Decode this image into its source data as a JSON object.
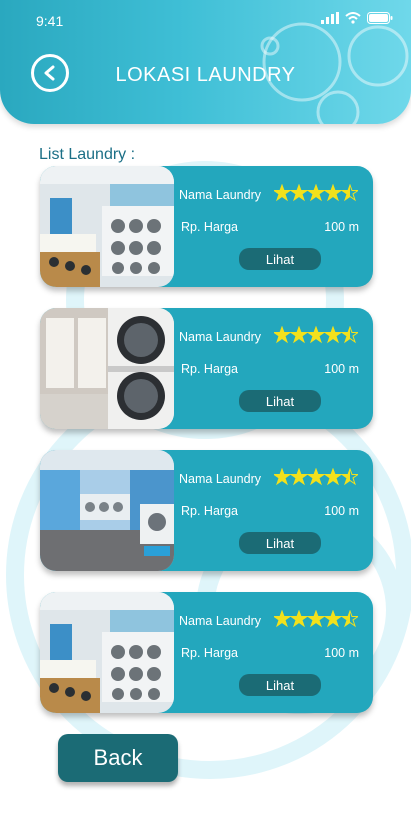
{
  "status_bar": {
    "time": "9:41"
  },
  "header": {
    "title": "LOKASI LAUNDRY",
    "back_icon": "chevron-left-icon"
  },
  "list_label": "List Laundry :",
  "laundries": [
    {
      "name": "Nama Laundry",
      "price": "Rp. Harga",
      "distance": "100 m",
      "rating": 4.5,
      "button": "Lihat"
    },
    {
      "name": "Nama Laundry",
      "price": "Rp. Harga",
      "distance": "100 m",
      "rating": 4.5,
      "button": "Lihat"
    },
    {
      "name": "Nama Laundry",
      "price": "Rp. Harga",
      "distance": "100 m",
      "rating": 4.5,
      "button": "Lihat"
    },
    {
      "name": "Nama Laundry",
      "price": "Rp. Harga",
      "distance": "100 m",
      "rating": 4.5,
      "button": "Lihat"
    }
  ],
  "back_button": "Back",
  "colors": {
    "header": "#2aa8bf",
    "card": "#23a7bd",
    "button": "#1b6b75",
    "star": "#f2e11c",
    "label": "#1b6f86"
  }
}
